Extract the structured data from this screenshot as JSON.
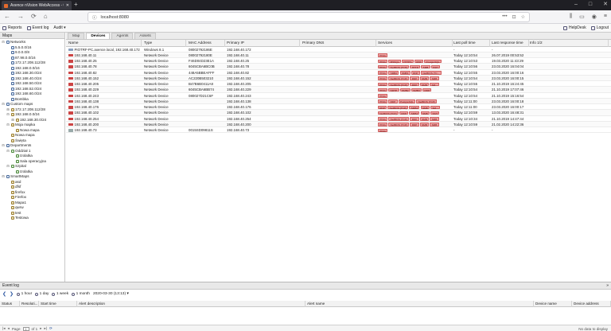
{
  "browser": {
    "tab_title": "Axence nVision WebAccess - 0...",
    "url": "localhost:8080",
    "new_tab": "+",
    "icons": [
      "back-icon",
      "forward-icon",
      "reload-icon",
      "home-icon",
      "info-icon",
      "more-icon",
      "bookmark-icon",
      "shield-icon",
      "star-icon",
      "library-icon",
      "reader-icon",
      "account-icon",
      "menu-icon"
    ]
  },
  "menubar": {
    "items": [
      {
        "label": "Reports"
      },
      {
        "label": "Event log"
      },
      {
        "label": "Audit ▾"
      }
    ],
    "right": [
      {
        "label": "HelpDesk"
      },
      {
        "label": "Logout"
      }
    ]
  },
  "left_panel": {
    "title": "Maps",
    "tree": [
      {
        "label": "Networks",
        "level": 0,
        "exp": "−",
        "kind": "folder"
      },
      {
        "label": "5.5.0.0/16",
        "level": 1,
        "exp": "",
        "kind": "net"
      },
      {
        "label": "9.0.0.0/8",
        "level": 1,
        "exp": "",
        "kind": "net"
      },
      {
        "label": "87.98.0.0/16",
        "level": 1,
        "exp": "",
        "kind": "net"
      },
      {
        "label": "172.17.208.112/28",
        "level": 1,
        "exp": "",
        "kind": "net"
      },
      {
        "label": "192.168.0.0/16",
        "level": 1,
        "exp": "",
        "kind": "net"
      },
      {
        "label": "192.168.30.0/24",
        "level": 1,
        "exp": "",
        "kind": "net"
      },
      {
        "label": "192.168.40.0/24",
        "level": 1,
        "exp": "",
        "kind": "net"
      },
      {
        "label": "192.168.50.0/24",
        "level": 1,
        "exp": "",
        "kind": "net"
      },
      {
        "label": "192.168.52.0/24",
        "level": 1,
        "exp": "",
        "kind": "net"
      },
      {
        "label": "192.168.60.0/24",
        "level": 1,
        "exp": "",
        "kind": "net"
      },
      {
        "label": "Bombka",
        "level": 1,
        "exp": "",
        "kind": "net"
      },
      {
        "label": "Custom maps",
        "level": 0,
        "exp": "−",
        "kind": "folder"
      },
      {
        "label": "172.17.208.112/28",
        "level": 1,
        "exp": "+",
        "kind": "map"
      },
      {
        "label": "192.168.0.0/24",
        "level": 1,
        "exp": "−",
        "kind": "map"
      },
      {
        "label": "192.168.30.0/24",
        "level": 2,
        "exp": "+",
        "kind": "map"
      },
      {
        "label": "Moja mapka",
        "level": 1,
        "exp": "−",
        "kind": "map"
      },
      {
        "label": "Nowa mapa",
        "level": 2,
        "exp": "",
        "kind": "map"
      },
      {
        "label": "Nowa mapa",
        "level": 1,
        "exp": "",
        "kind": "map"
      },
      {
        "label": "Święta",
        "level": 1,
        "exp": "",
        "kind": "map"
      },
      {
        "label": "Departments",
        "level": 0,
        "exp": "−",
        "kind": "folder"
      },
      {
        "label": "Oddział 1",
        "level": 1,
        "exp": "−",
        "kind": "dep"
      },
      {
        "label": "Izolatka",
        "level": 2,
        "exp": "",
        "kind": "dep"
      },
      {
        "label": "Sala operacyjna",
        "level": 2,
        "exp": "",
        "kind": "dep"
      },
      {
        "label": "Szpital",
        "level": 1,
        "exp": "−",
        "kind": "dep"
      },
      {
        "label": "Izolatka",
        "level": 2,
        "exp": "",
        "kind": "dep"
      },
      {
        "label": "SmartMaps",
        "level": 0,
        "exp": "−",
        "kind": "folder"
      },
      {
        "label": "asd",
        "level": 1,
        "exp": "",
        "kind": "map"
      },
      {
        "label": "dfsf",
        "level": 1,
        "exp": "",
        "kind": "map"
      },
      {
        "label": "firefox",
        "level": 1,
        "exp": "",
        "kind": "map"
      },
      {
        "label": "Firefox",
        "level": 1,
        "exp": "",
        "kind": "map"
      },
      {
        "label": "Mapa1",
        "level": 1,
        "exp": "",
        "kind": "map"
      },
      {
        "label": "qwrw",
        "level": 1,
        "exp": "",
        "kind": "map"
      },
      {
        "label": "test",
        "level": 1,
        "exp": "",
        "kind": "map"
      },
      {
        "label": "Testowa",
        "level": 1,
        "exp": "",
        "kind": "map"
      }
    ]
  },
  "main": {
    "tabs": [
      "Map",
      "Devices",
      "Agents",
      "Assets"
    ],
    "active_tab": 1,
    "columns": [
      "Name",
      "Type",
      "MAC Address",
      "Primary IP",
      "Primary DNS",
      "Services",
      "Last poll time",
      "Last response time",
      "Info 1/2"
    ],
    "rows": [
      {
        "name": "PIOTRF-PC.axence.local, 192.168.40.172",
        "type": "Windows 8.1",
        "mac": "08002792186E",
        "ip": "192.168.40.172",
        "dns": "",
        "services": [],
        "poll": "-",
        "resp": "-",
        "icon": "pc"
      },
      {
        "name": "192.168.40.11",
        "type": "Network Device",
        "mac": "08002792180E",
        "ip": "192.168.40.11",
        "dns": "",
        "services": [
          "PING"
        ],
        "poll": "Today 12:10:54",
        "resp": "26.07.2019 00:53:52",
        "icon": "red"
      },
      {
        "name": "192.168.40.25",
        "type": "Network Device",
        "mac": "F46D04D23E1A",
        "ip": "192.168.40.25",
        "dns": "",
        "services": [
          "PING",
          "MSSQL",
          "HTTPS",
          "RDP",
          "PostgreSQL"
        ],
        "poll": "Today 12:10:53",
        "resp": "19.03.2020 11:43:29",
        "icon": "red"
      },
      {
        "name": "192.168.40.78",
        "type": "Network Device",
        "mac": "6045CBA6BC0B",
        "ip": "192.168.40.78",
        "dns": "",
        "services": [
          "PING",
          "NetBIOS (TCP)",
          "HTTP",
          "SMB",
          "SSH"
        ],
        "poll": "Today 12:10:56",
        "resp": "23.03.2020 16:04:04",
        "icon": "red"
      },
      {
        "name": "192.168.40.82",
        "type": "Network Device",
        "mac": "448A5BBEAFFF",
        "ip": "192.168.40.82",
        "dns": "",
        "services": [
          "PING",
          "SMB2",
          "SMB3",
          "RDP",
          "NetBIOS (TC..."
        ],
        "poll": "Today 12:10:55",
        "resp": "23.03.2020 16:00:16",
        "icon": "red"
      },
      {
        "name": "192.168.40.152",
        "type": "Network Device",
        "mac": "AC220B503210",
        "ip": "192.168.40.152",
        "dns": "",
        "services": [
          "PING",
          "NetBIOS (TCP)",
          "RDP",
          "SMB",
          "SMB"
        ],
        "poll": "Today 12:10:54",
        "resp": "23.03.2020 16:00:15",
        "icon": "red"
      },
      {
        "name": "192.168.40.205",
        "type": "Network Device",
        "mac": "B47B6B0411A8",
        "ip": "192.168.40.205",
        "dns": "",
        "services": [
          "PING",
          "NetBIOS (TCP)",
          "RDP",
          "SMB",
          "SM..."
        ],
        "poll": "Today 12:10:55",
        "resp": "21.10.2019 16:24:45",
        "icon": "red"
      },
      {
        "name": "192.168.40.229",
        "type": "Network Device",
        "mac": "6045CBA6BB74",
        "ip": "192.168.40.229",
        "dns": "",
        "services": [
          "PING",
          "SMTP",
          "SMB2",
          "SMB3",
          "RDP"
        ],
        "poll": "Today 12:10:54",
        "resp": "21.10.2019 17:07:46",
        "icon": "red"
      },
      {
        "name": "192.168.40.243",
        "type": "Network Device",
        "mac": "080027D21C6F",
        "ip": "192.168.40.243",
        "dns": "",
        "services": [
          "PING"
        ],
        "poll": "Today 12:10:54",
        "resp": "21.10.2019 15:16:54",
        "icon": "red"
      },
      {
        "name": "192.168.40.138",
        "type": "Network Device",
        "mac": "",
        "ip": "192.168.40.138",
        "dns": "",
        "services": [
          "PING",
          "RDP",
          "PostgreSQL",
          "NetBIOS (TCP)"
        ],
        "poll": "Today 12:11:00",
        "resp": "23.03.2020 16:00:18",
        "icon": "red"
      },
      {
        "name": "192.168.40.176",
        "type": "Network Device",
        "mac": "",
        "ip": "192.168.40.176",
        "dns": "",
        "services": [
          "RDP",
          "NetBIOS (TCP)",
          "SMB2",
          "SMB",
          "SM..."
        ],
        "poll": "Today 12:11:00",
        "resp": "23.03.2020 16:00:17",
        "icon": "red"
      },
      {
        "name": "192.168.40.102",
        "type": "Network Device",
        "mac": "",
        "ip": "192.168.40.102",
        "dns": "",
        "services": [
          "NetBIOS (TCP)",
          "RDP",
          "SMB2",
          "SMB",
          "SSH"
        ],
        "poll": "Today 12:10:59",
        "resp": "13.03.2020 16:48:31",
        "icon": "red"
      },
      {
        "name": "192.168.40.254",
        "type": "Network Device",
        "mac": "",
        "ip": "192.168.40.254",
        "dns": "",
        "services": [
          "PING",
          "NetBIOS (TCP)",
          "RDP",
          "SMB",
          "SMB"
        ],
        "poll": "Today 12:10:34",
        "resp": "21.10.2019 14:47:44",
        "icon": "red"
      },
      {
        "name": "192.168.40.200",
        "type": "Network Device",
        "mac": "",
        "ip": "192.168.40.200",
        "dns": "",
        "services": [
          "PING",
          "NetBIOS (TCP)",
          "RDP",
          "SMB",
          "SMB"
        ],
        "poll": "Today 12:10:59",
        "resp": "21.02.2020 14:22:36",
        "icon": "red"
      },
      {
        "name": "192.168.40.73",
        "type": "Network Device",
        "mac": "0015SD09811S",
        "ip": "192.168.40.73",
        "dns": "",
        "services": [
          "PING"
        ],
        "poll": "-",
        "resp": "-",
        "icon": "grey"
      }
    ]
  },
  "event_log": {
    "title": "Event log",
    "close": "»",
    "filters": [
      "1 hour",
      "1 day",
      "1 week",
      "1 month"
    ],
    "date": "2020-03-30 (13:13) ▾",
    "columns": [
      "Status",
      "Resoluti...",
      "Start time",
      "Alert description",
      "Alert name",
      "Device name",
      "Device address"
    ],
    "pager": {
      "page_label": "Page",
      "page_value": "1",
      "of_label": "of 1",
      "no_data": "No data to display"
    }
  }
}
